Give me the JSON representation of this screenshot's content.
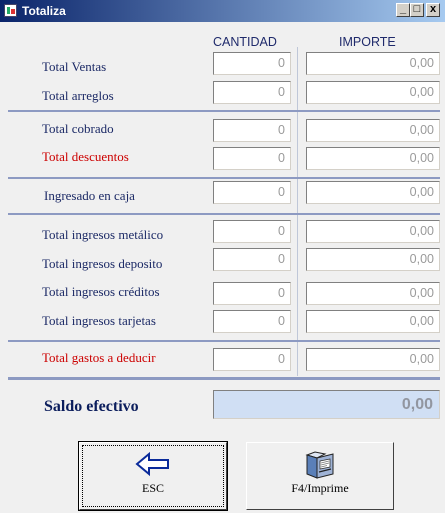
{
  "window": {
    "title": "Totaliza",
    "minimize_glyph": "_",
    "maximize_glyph": "□",
    "close_glyph": "x"
  },
  "columns": {
    "cantidad": "CANTIDAD",
    "importe": "IMPORTE"
  },
  "rows": [
    {
      "label": "Total Ventas",
      "qty": "0",
      "amount": "0,00",
      "color": "#1c2a66"
    },
    {
      "label": "Total arreglos",
      "qty": "0",
      "amount": "0,00",
      "color": "#1c2a66"
    },
    {
      "label": "Total cobrado",
      "qty": "0",
      "amount": "0,00",
      "color": "#1c2a66"
    },
    {
      "label": "Total descuentos",
      "qty": "0",
      "amount": "0,00",
      "color": "#cc0000"
    },
    {
      "label": "Ingresado en caja",
      "qty": "0",
      "amount": "0,00",
      "color": "#1c2a66"
    },
    {
      "label": "Total ingresos metálico",
      "qty": "0",
      "amount": "0,00",
      "color": "#1c2a66"
    },
    {
      "label": "Total ingresos deposito",
      "qty": "0",
      "amount": "0,00",
      "color": "#1c2a66"
    },
    {
      "label": "Total ingresos créditos",
      "qty": "0",
      "amount": "0,00",
      "color": "#1c2a66"
    },
    {
      "label": "Total ingresos tarjetas",
      "qty": "0",
      "amount": "0,00",
      "color": "#1c2a66"
    },
    {
      "label": "Total gastos a deducir",
      "qty": "0",
      "amount": "0,00",
      "color": "#cc0000"
    }
  ],
  "saldo": {
    "label": "Saldo efectivo",
    "value": "0,00"
  },
  "buttons": {
    "esc": {
      "label": "ESC",
      "icon": "arrow-left-icon"
    },
    "print": {
      "label": "F4/Imprime",
      "icon": "printer-icon"
    }
  }
}
